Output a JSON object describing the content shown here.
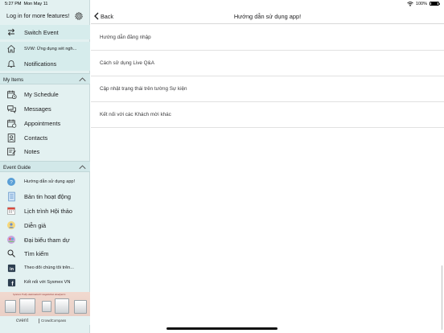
{
  "status_bar": {
    "time": "5:27 PM",
    "date": "Mon May 11",
    "battery": "100%",
    "battery_level": 1.0
  },
  "sidebar": {
    "header_title": "Log in for more features!",
    "top_items": [
      {
        "label": "Switch Event",
        "icon": "switch-arrows-icon"
      },
      {
        "label": "SVW: Ứng dụng xét ngh...",
        "icon": "home-icon"
      },
      {
        "label": "Notifications",
        "icon": "bell-icon"
      }
    ],
    "my_items_title": "My Items",
    "my_items": [
      {
        "label": "My Schedule",
        "icon": "schedule-icon"
      },
      {
        "label": "Messages",
        "icon": "messages-icon"
      },
      {
        "label": "Appointments",
        "icon": "calendar-icon"
      },
      {
        "label": "Contacts",
        "icon": "contacts-icon"
      },
      {
        "label": "Notes",
        "icon": "notes-icon"
      }
    ],
    "event_guide_title": "Event Guide",
    "event_guide": [
      {
        "label": "Hướng dẫn sử dụng app!",
        "icon": "help-icon"
      },
      {
        "label": "Bản tin hoạt động",
        "icon": "news-icon"
      },
      {
        "label": "Lịch trình Hội thảo",
        "icon": "agenda-icon"
      },
      {
        "label": "Diễn giả",
        "icon": "speaker-icon"
      },
      {
        "label": "Đại biểu tham dự",
        "icon": "attendees-icon"
      },
      {
        "label": "Tìm kiếm",
        "icon": "search-icon"
      },
      {
        "label": "Theo dõi chúng tôi trên...",
        "icon": "linkedin-icon"
      },
      {
        "label": "Kết nối với Sysmex VN",
        "icon": "facebook-icon"
      }
    ],
    "banner_text": "Sysmex Fully Automated Coagulation Analyzers",
    "footer_brand": "cvent",
    "footer_product": "CrowdCompass"
  },
  "main": {
    "back_label": "Back",
    "title": "Hướng dẫn sử dụng app!",
    "items": [
      "Hướng dẫn đăng nhập",
      "Cách sử dụng Live Q&A",
      "Cập nhật trạng thái trên tường Sự kiện",
      "Kết nối với các Khách mời khác"
    ]
  },
  "colors": {
    "sidebar_bg": "#e3f1f1",
    "section_bg": "#d2e8e9",
    "text": "#1c1c1e"
  }
}
